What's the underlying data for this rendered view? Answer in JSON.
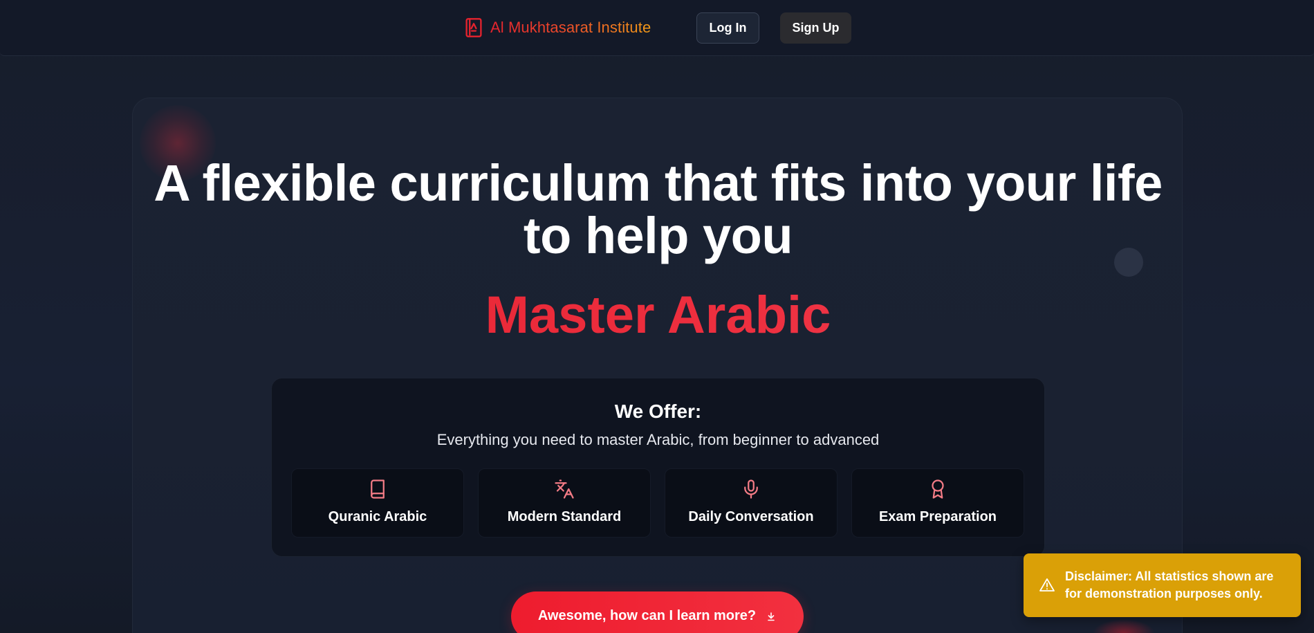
{
  "header": {
    "brand_name": "Al Mukhtasarat Institute",
    "brand_icon": "book-icon",
    "login_label": "Log In",
    "signup_label": "Sign Up"
  },
  "hero": {
    "title": "A flexible curriculum that fits into your life to help you",
    "highlight": "Master Arabic"
  },
  "offer": {
    "heading": "We Offer:",
    "subheading": "Everything you need to master Arabic, from beginner to advanced",
    "items": [
      {
        "label": "Quranic Arabic",
        "icon": "book-icon"
      },
      {
        "label": "Modern Standard",
        "icon": "languages-icon"
      },
      {
        "label": "Daily Conversation",
        "icon": "microphone-icon"
      },
      {
        "label": "Exam Preparation",
        "icon": "award-icon"
      }
    ]
  },
  "cta": {
    "label": "Awesome, how can I learn more?",
    "icon": "arrow-down-icon"
  },
  "toast": {
    "icon": "warning-icon",
    "text": "Disclaimer: All statistics shown are for demonstration purposes only."
  },
  "colors": {
    "accent_red": "#ee1c2e",
    "brand_orange": "#f29a18",
    "toast_yellow": "#daa007",
    "background": "#161c2a",
    "icon_pink": "#f47c86"
  }
}
